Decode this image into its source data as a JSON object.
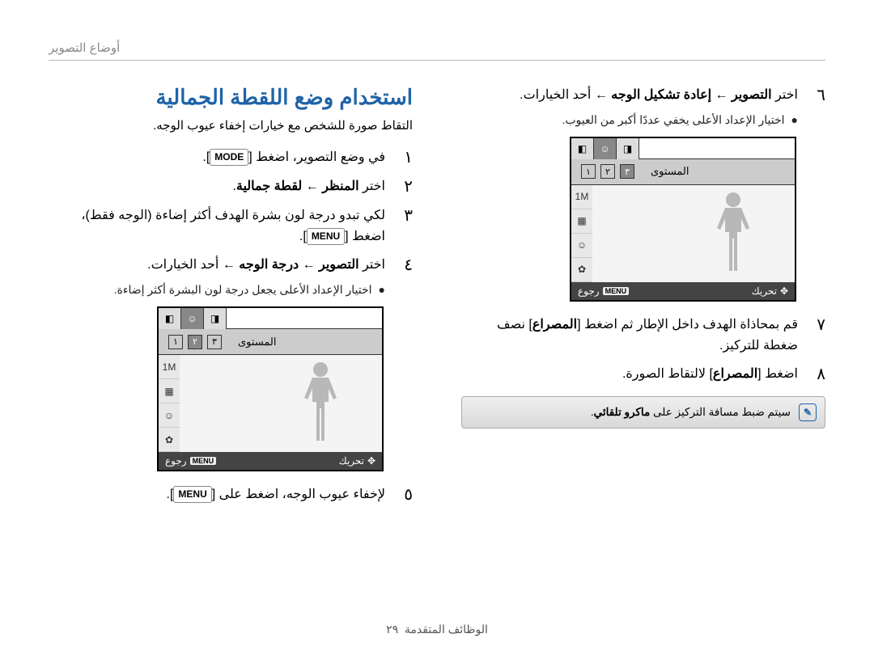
{
  "chapter": "أوضاع التصوير",
  "title": "استخدام وضع اللقطة الجمالية",
  "intro": "التقاط صورة للشخص مع خيارات إخفاء عيوب الوجه.",
  "step1": {
    "num": "١",
    "prefix": "في وضع التصوير، اضغط ",
    "key": "MODE",
    "suffix": "."
  },
  "step2": {
    "num": "٢",
    "prefix": "اختر ",
    "b1": "المنظر",
    "sep": " ← ",
    "b2": "لقطة جمالية",
    "suffix": "."
  },
  "step3": {
    "num": "٣",
    "line1": "لكي تبدو درجة لون بشرة الهدف أكثر إضاءة (الوجه فقط)،",
    "line2_prefix": "اضغط ",
    "line2_key": "MENU",
    "line2_suffix": "."
  },
  "step4": {
    "num": "٤",
    "b1_prefix": "اختر ",
    "b1": "التصوير",
    "sep": " ← ",
    "b2": "درجة الوجه",
    "sep2": " ← ",
    "rest": "أحد الخيارات.",
    "bullet": "اختيار الإعداد الأعلى يجعل درجة لون البشرة أكثر إضاءة."
  },
  "step5": {
    "num": "٥",
    "prefix": "لإخفاء عيوب الوجه، اضغط على ",
    "key": "MENU",
    "suffix": "."
  },
  "step6": {
    "num": "٦",
    "b1_prefix": "اختر ",
    "b1": "التصوير",
    "sep": " ← ",
    "b2": "إعادة تشكيل الوجه",
    "sep2": " ← ",
    "rest": "أحد الخيارات.",
    "bullet": "اختيار الإعداد الأعلى يخفي عددًا أكبر من العيوب."
  },
  "step7": {
    "num": "٧",
    "prefix": "قم بمحاذاة الهدف داخل الإطار ثم اضغط [",
    "b": "المصراع",
    "suffix": "] نصف ضغطة للتركيز."
  },
  "step8": {
    "num": "٨",
    "prefix": "اضغط [",
    "b": "المصراع",
    "suffix": "] لالتقاط الصورة."
  },
  "note": {
    "prefix": "سيتم ضبط مسافة التركيز على ",
    "b": "ماكرو تلقائي",
    "suffix": "."
  },
  "screenA": {
    "level_label": "المستوى",
    "level_value": "٢",
    "bottom_move_label": "تحريك",
    "bottom_back_label": "رجوع",
    "bottom_menu": "MENU"
  },
  "screenB": {
    "level_label": "المستوى",
    "level_value": "٣",
    "bottom_move_label": "تحريك",
    "bottom_back_label": "رجوع",
    "bottom_menu": "MENU"
  },
  "footer": {
    "section": "الوظائف المتقدمة",
    "page": "٢٩"
  }
}
